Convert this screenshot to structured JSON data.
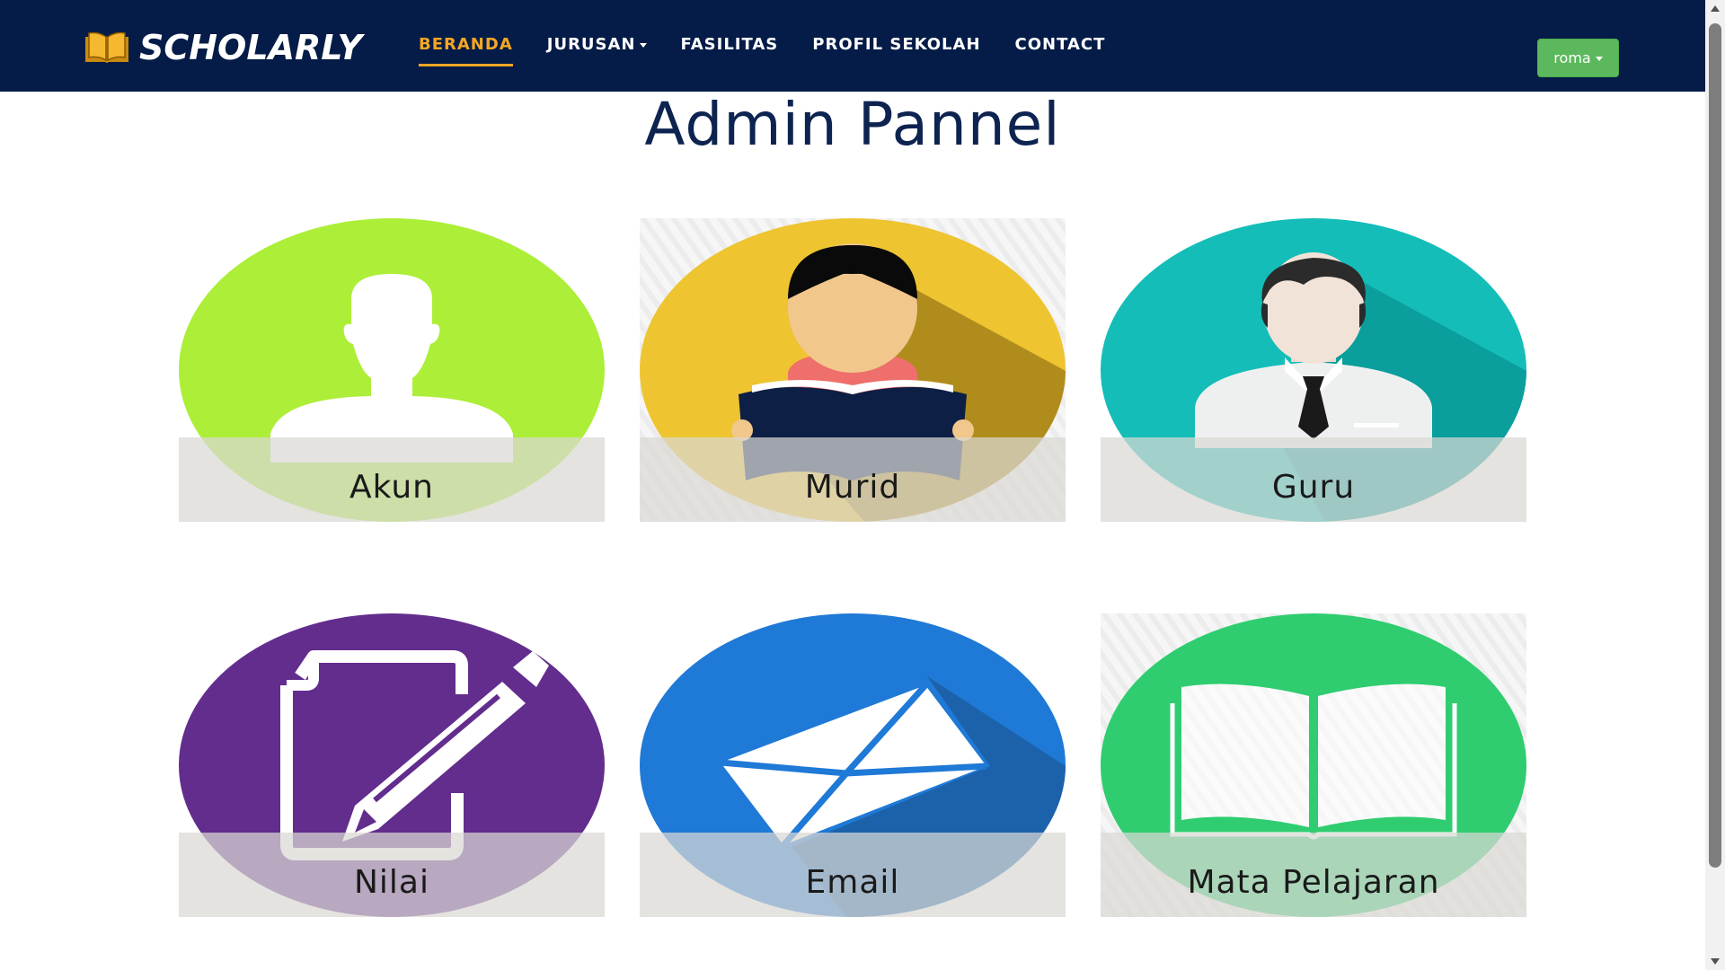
{
  "brand": {
    "name": "SCHOLARLY",
    "icon": "open-book-icon",
    "accent_color": "#f5a623"
  },
  "nav": {
    "items": [
      {
        "label": "BERANDA",
        "active": true
      },
      {
        "label": "JURUSAN",
        "dropdown": true
      },
      {
        "label": "FASILITAS"
      },
      {
        "label": "PROFIL SEKOLAH"
      },
      {
        "label": "CONTACT"
      }
    ],
    "background_color": "#041c47"
  },
  "user_menu": {
    "label": "roma",
    "color": "#5cb85c"
  },
  "page": {
    "title": "Admin Pannel"
  },
  "cards": [
    {
      "label": "Akun",
      "icon": "user-silhouette-icon",
      "color": "#acee38"
    },
    {
      "label": "Murid",
      "icon": "student-reading-icon",
      "color": "#eec431"
    },
    {
      "label": "Guru",
      "icon": "teacher-icon",
      "color": "#14bdb8"
    },
    {
      "label": "Nilai",
      "icon": "edit-document-icon",
      "color": "#622d8d"
    },
    {
      "label": "Email",
      "icon": "envelope-icon",
      "color": "#1f79d6"
    },
    {
      "label": "Mata Pelajaran",
      "icon": "open-book-icon",
      "color": "#2fcd70"
    }
  ]
}
